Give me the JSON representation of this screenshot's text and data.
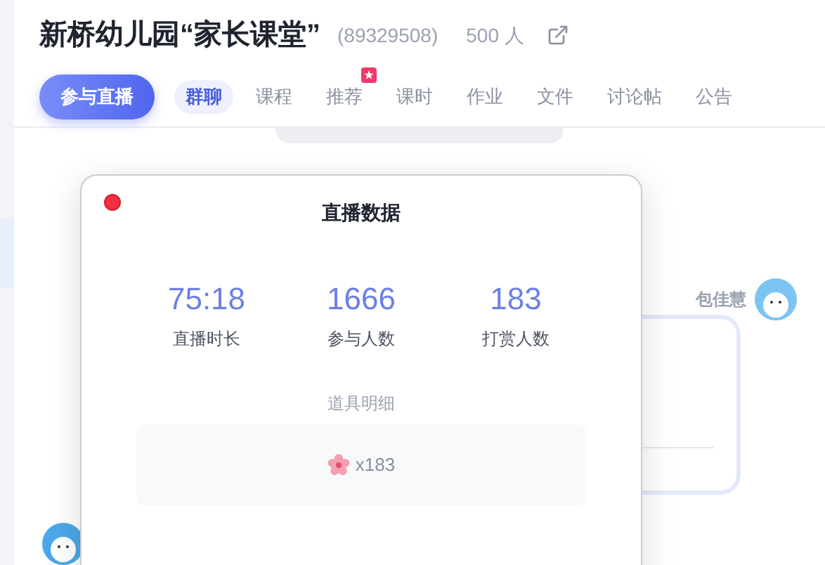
{
  "header": {
    "title": "新桥幼儿园“家长课堂”",
    "group_id": "(89329508)",
    "member_count": "500 人"
  },
  "live_button": {
    "label": "参与直播"
  },
  "tabs": [
    {
      "label": "群聊",
      "selected": true,
      "badge": false
    },
    {
      "label": "课程",
      "selected": false,
      "badge": false
    },
    {
      "label": "推荐",
      "selected": false,
      "badge": true
    },
    {
      "label": "课时",
      "selected": false,
      "badge": false
    },
    {
      "label": "作业",
      "selected": false,
      "badge": false
    },
    {
      "label": "文件",
      "selected": false,
      "badge": false
    },
    {
      "label": "讨论帖",
      "selected": false,
      "badge": false
    },
    {
      "label": "公告",
      "selected": false,
      "badge": false
    }
  ],
  "chat": {
    "sender_name": "包佳慧"
  },
  "dialog": {
    "title": "直播数据",
    "stats": [
      {
        "value": "75:18",
        "label": "直播时长"
      },
      {
        "value": "1666",
        "label": "参与人数"
      },
      {
        "value": "183",
        "label": "打赏人数"
      }
    ],
    "gifts_heading": "道具明细",
    "gifts": [
      {
        "count": "x183"
      }
    ]
  }
}
